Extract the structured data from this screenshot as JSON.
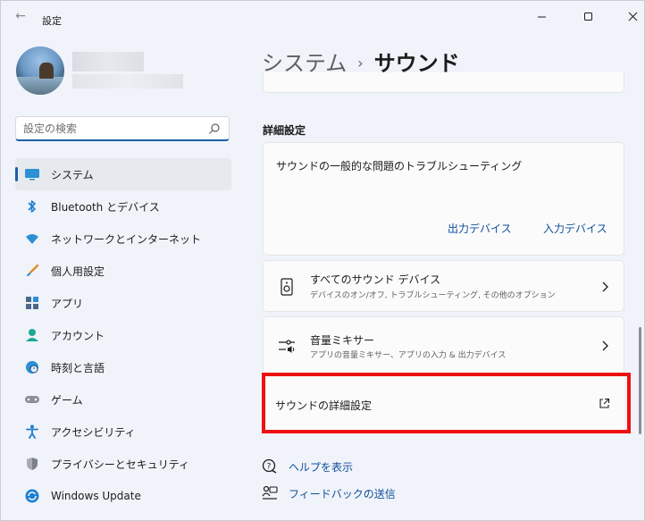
{
  "window": {
    "app_title": "設定",
    "back_glyph": "←",
    "min_glyph": "—",
    "max_glyph": "☐",
    "close_glyph": "✕"
  },
  "search": {
    "placeholder": "設定の検索",
    "value": ""
  },
  "sidebar": {
    "items": [
      {
        "label": "システム",
        "icon": "monitor-icon",
        "active": true
      },
      {
        "label": "Bluetooth とデバイス",
        "icon": "bluetooth-icon"
      },
      {
        "label": "ネットワークとインターネット",
        "icon": "wifi-icon"
      },
      {
        "label": "個人用設定",
        "icon": "brush-icon"
      },
      {
        "label": "アプリ",
        "icon": "apps-icon"
      },
      {
        "label": "アカウント",
        "icon": "person-icon"
      },
      {
        "label": "時刻と言語",
        "icon": "globe-clock-icon"
      },
      {
        "label": "ゲーム",
        "icon": "gamepad-icon"
      },
      {
        "label": "アクセシビリティ",
        "icon": "accessibility-icon"
      },
      {
        "label": "プライバシーとセキュリティ",
        "icon": "shield-icon"
      },
      {
        "label": "Windows Update",
        "icon": "update-icon"
      }
    ]
  },
  "header": {
    "parent": "システム",
    "separator": "›",
    "current": "サウンド"
  },
  "advanced": {
    "section_label": "詳細設定",
    "troubleshoot": {
      "title": "サウンドの一般的な問題のトラブルシューティング",
      "output_link": "出力デバイス",
      "input_link": "入力デバイス"
    },
    "all_devices": {
      "title": "すべてのサウンド デバイス",
      "subtitle": "デバイスのオン/オフ, トラブルシューティング, その他のオプション"
    },
    "mixer": {
      "title": "音量ミキサー",
      "subtitle": "アプリの音量ミキサー、アプリの入力 & 出力デバイス"
    },
    "more_settings": {
      "label": "サウンドの詳細設定"
    }
  },
  "footer": {
    "help": "ヘルプを表示",
    "feedback": "フィードバックの送信"
  },
  "colors": {
    "accent": "#1d5fa8",
    "link": "#0f4f9a",
    "highlight": "#ee1111"
  }
}
